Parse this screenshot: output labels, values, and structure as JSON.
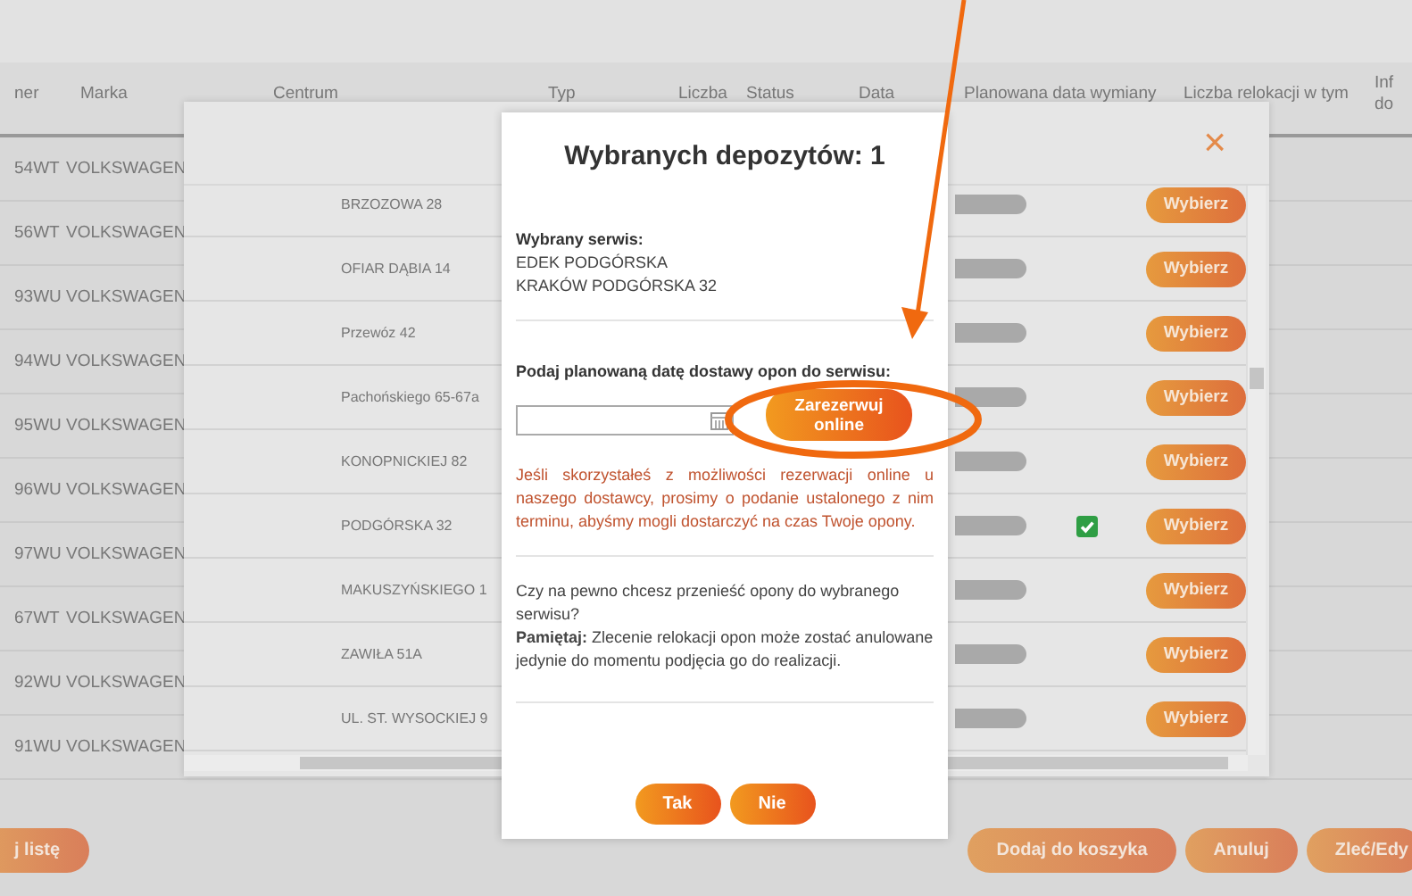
{
  "table": {
    "columns": [
      {
        "label": "ner"
      },
      {
        "label": "Marka"
      },
      {
        "label": "Centrum"
      },
      {
        "label": "Typ"
      },
      {
        "label": "Liczba"
      },
      {
        "label": "Status"
      },
      {
        "label": "Data"
      },
      {
        "label": "Planowana data wymiany"
      },
      {
        "label": "Liczba relokacji w tym"
      },
      {
        "label": "Inf do"
      }
    ],
    "rows": [
      {
        "plate": "54WT",
        "brand": "VOLKSWAGEN"
      },
      {
        "plate": "56WT",
        "brand": "VOLKSWAGEN"
      },
      {
        "plate": "93WU",
        "brand": "VOLKSWAGEN"
      },
      {
        "plate": "94WU",
        "brand": "VOLKSWAGEN"
      },
      {
        "plate": "95WU",
        "brand": "VOLKSWAGEN"
      },
      {
        "plate": "96WU",
        "brand": "VOLKSWAGEN"
      },
      {
        "plate": "97WU",
        "brand": "VOLKSWAGEN"
      },
      {
        "plate": "67WT",
        "brand": "VOLKSWAGEN"
      },
      {
        "plate": "92WU",
        "brand": "VOLKSWAGEN"
      },
      {
        "plate": "91WU",
        "brand": "VOLKSWAGEN"
      }
    ]
  },
  "left_button": "j listę",
  "footer_buttons": [
    "Dodaj do koszyka",
    "Anuluj",
    "Zleć/Edy"
  ],
  "service_dialog": {
    "close": "×",
    "rows": [
      {
        "address": "BRZOZOWA 28",
        "checked": false,
        "action": "Wybierz"
      },
      {
        "address": "OFIAR DĄBIA 14",
        "checked": false,
        "action": "Wybierz"
      },
      {
        "address": "Przewóz 42",
        "checked": false,
        "action": "Wybierz"
      },
      {
        "address": "Pachońskiego 65-67a",
        "checked": false,
        "action": "Wybierz"
      },
      {
        "address": "KONOPNICKIEJ 82",
        "checked": false,
        "action": "Wybierz"
      },
      {
        "address": "PODGÓRSKA 32",
        "checked": true,
        "action": "Wybierz"
      },
      {
        "address": "MAKUSZYŃSKIEGO 1",
        "checked": false,
        "action": "Wybierz"
      },
      {
        "address": "ZAWIŁA 51A",
        "checked": false,
        "action": "Wybierz"
      },
      {
        "address": "UL. ST. WYSOCKIEJ 9",
        "checked": false,
        "action": "Wybierz"
      }
    ]
  },
  "confirm_dialog": {
    "title": "Wybranych depozytów: 1",
    "service_label": "Wybrany serwis:",
    "service_lines": [
      "EDEK PODGÓRSKA",
      "KRAKÓW PODGÓRSKA 32"
    ],
    "date_label": "Podaj planowaną datę dostawy opon do serwisu:",
    "reserve_button": "Zarezerwuj online",
    "warning": "Jeśli skorzystałeś z możliwości rezerwacji online u naszego dostawcy, prosimy o podanie ustalonego z nim terminu, abyśmy mogli dostarczyć na czas Twoje opony.",
    "question": "Czy na pewno chcesz przenieść opony do wybranego serwisu?",
    "note": "**Pamiętaj:** Zlecenie relokacji opon może zostać anulowane jedynie do momentu podjęcia go do realizacji.",
    "buttons": [
      "Tak",
      "Nie"
    ]
  }
}
